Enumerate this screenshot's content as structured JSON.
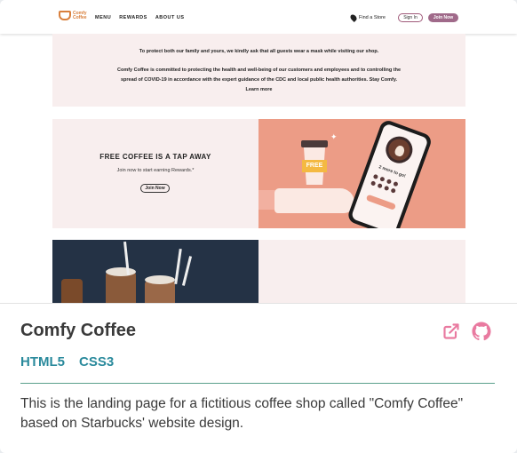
{
  "preview": {
    "logo_text": "Comfy Coffee",
    "nav": [
      "MENU",
      "REWARDS",
      "ABOUT US"
    ],
    "find_store": "Find a Store",
    "sign_in": "Sign In",
    "join_now": "Join Now",
    "notice_line1": "To protect both our family and yours, we kindly ask that all guests wear a mask while visiting our shop.",
    "notice_line2": "Comfy Coffee is committed to protecting the health and well-being of our customers and employees and to controlling the spread of COVID-19 in accordance with the expert guidance of the CDC and local public health authorities. Stay Comfy. Learn more",
    "promo_title": "FREE COFFEE IS A TAP AWAY",
    "promo_sub": "Join now to start earning Rewards.*",
    "promo_button": "Join Now",
    "cup_label": "FREE",
    "phone_text": "2 more to go!"
  },
  "project": {
    "title": "Comfy Coffee",
    "tags": [
      "HTML5",
      "CSS3"
    ],
    "description": "This is the landing page for a fictitious coffee shop called \"Comfy Coffee\" based on Starbucks' website design."
  },
  "colors": {
    "accent_icon": "#e97aa0",
    "tag": "#2a8a9c",
    "divider": "#5aa08c",
    "promo_art": "#ec9c86"
  },
  "icons": [
    "external-link-icon",
    "github-icon"
  ]
}
